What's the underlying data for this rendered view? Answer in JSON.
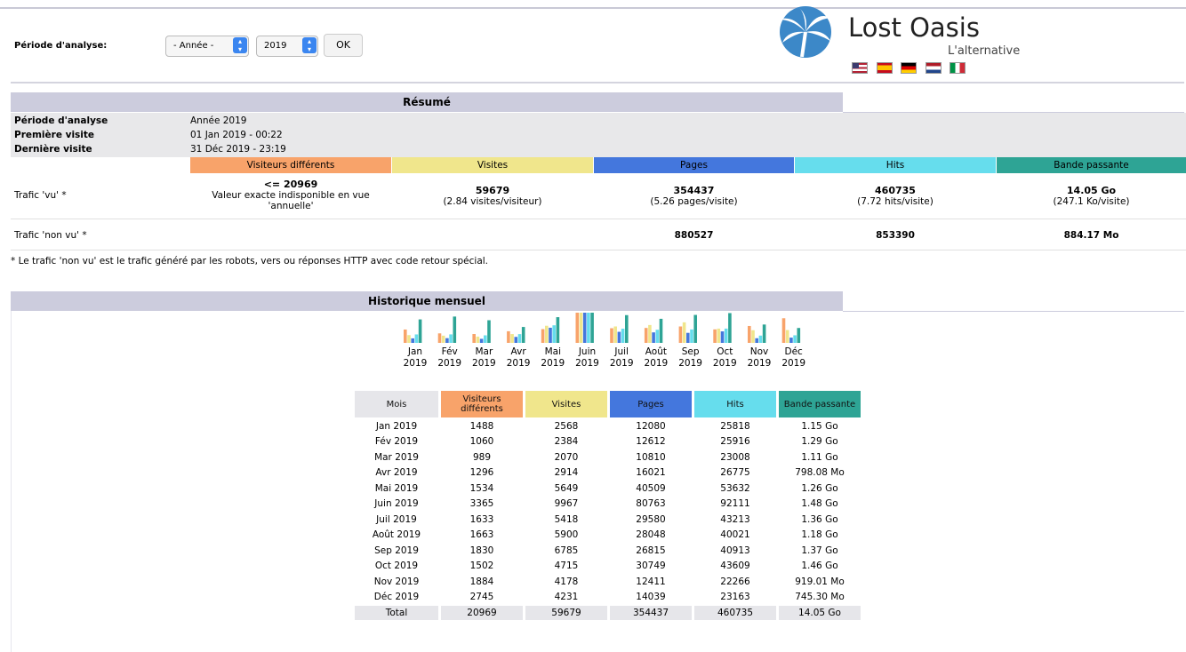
{
  "period": {
    "label": "Période d'analyse:",
    "select_period": "- Année -",
    "select_year": "2019",
    "ok_label": "OK"
  },
  "brand": {
    "name": "Lost Oasis",
    "tagline": "L'alternative",
    "flags": [
      "us-flag",
      "es-flag",
      "de-flag",
      "nl-flag",
      "it-flag"
    ]
  },
  "summary": {
    "title": "Résumé",
    "rows": [
      {
        "label": "Période d'analyse",
        "value": "Année 2019"
      },
      {
        "label": "Première visite",
        "value": "01 Jan 2019 - 00:22"
      },
      {
        "label": "Dernière visite",
        "value": "31 Déc 2019 - 23:19"
      }
    ],
    "columns": [
      "Visiteurs différents",
      "Visites",
      "Pages",
      "Hits",
      "Bande passante"
    ],
    "viewed": {
      "label": "Trafic 'vu' *",
      "visitors": "<= 20969",
      "visitors_note": "Valeur exacte indisponible en vue 'annuelle'",
      "visits": "59679",
      "visits_sub": "(2.84 visites/visiteur)",
      "pages": "354437",
      "pages_sub": "(5.26 pages/visite)",
      "hits": "460735",
      "hits_sub": "(7.72 hits/visite)",
      "bandwidth": "14.05 Go",
      "bandwidth_sub": "(247.1 Ko/visite)"
    },
    "not_viewed": {
      "label": "Trafic 'non vu' *",
      "pages": "880527",
      "hits": "853390",
      "bandwidth": "884.17 Mo"
    },
    "note": "* Le trafic 'non vu' est le trafic généré par les robots, vers ou réponses HTTP avec code retour spécial."
  },
  "monthly": {
    "title": "Historique mensuel",
    "headers": [
      "Mois",
      "Visiteurs différents",
      "Visites",
      "Pages",
      "Hits",
      "Bande passante"
    ],
    "rows": [
      [
        "Jan 2019",
        "1488",
        "2568",
        "12080",
        "25818",
        "1.15 Go"
      ],
      [
        "Fév 2019",
        "1060",
        "2384",
        "12612",
        "25916",
        "1.29 Go"
      ],
      [
        "Mar 2019",
        "989",
        "2070",
        "10810",
        "23008",
        "1.11 Go"
      ],
      [
        "Avr 2019",
        "1296",
        "2914",
        "16021",
        "26775",
        "798.08 Mo"
      ],
      [
        "Mai 2019",
        "1534",
        "5649",
        "40509",
        "53632",
        "1.26 Go"
      ],
      [
        "Juin 2019",
        "3365",
        "9967",
        "80763",
        "92111",
        "1.48 Go"
      ],
      [
        "Juil 2019",
        "1633",
        "5418",
        "29580",
        "43213",
        "1.36 Go"
      ],
      [
        "Août 2019",
        "1663",
        "5900",
        "28048",
        "40021",
        "1.18 Go"
      ],
      [
        "Sep 2019",
        "1830",
        "6785",
        "26815",
        "40913",
        "1.37 Go"
      ],
      [
        "Oct 2019",
        "1502",
        "4715",
        "30749",
        "43609",
        "1.46 Go"
      ],
      [
        "Nov 2019",
        "1884",
        "4178",
        "12411",
        "22266",
        "919.01 Mo"
      ],
      [
        "Déc 2019",
        "2745",
        "4231",
        "14039",
        "23163",
        "745.30 Mo"
      ]
    ],
    "total": [
      "Total",
      "20969",
      "59679",
      "354437",
      "460735",
      "14.05 Go"
    ],
    "chart_months": [
      [
        "Jan",
        "2019"
      ],
      [
        "Fév",
        "2019"
      ],
      [
        "Mar",
        "2019"
      ],
      [
        "Avr",
        "2019"
      ],
      [
        "Mai",
        "2019"
      ],
      [
        "Juin",
        "2019"
      ],
      [
        "Juil",
        "2019"
      ],
      [
        "Août",
        "2019"
      ],
      [
        "Sep",
        "2019"
      ],
      [
        "Oct",
        "2019"
      ],
      [
        "Nov",
        "2019"
      ],
      [
        "Déc",
        "2019"
      ]
    ]
  },
  "chart_data": {
    "type": "bar",
    "categories": [
      "Jan 2019",
      "Fév 2019",
      "Mar 2019",
      "Avr 2019",
      "Mai 2019",
      "Juin 2019",
      "Juil 2019",
      "Août 2019",
      "Sep 2019",
      "Oct 2019",
      "Nov 2019",
      "Déc 2019"
    ],
    "series": [
      {
        "values": [
          1488,
          1060,
          989,
          1296,
          1534,
          3365,
          1633,
          1663,
          1830,
          1502,
          1884,
          2745
        ],
        "color": "#f8a36a"
      },
      {
        "values": [
          2568,
          2384,
          2070,
          2914,
          5649,
          9967,
          5418,
          5900,
          6785,
          4715,
          4178,
          4231
        ],
        "color": "#f0e68c"
      },
      {
        "values": [
          12080,
          12612,
          10810,
          16021,
          40509,
          80763,
          29580,
          28048,
          26815,
          30749,
          12411,
          14039
        ],
        "color": "#4477dd"
      },
      {
        "values": [
          25818,
          25916,
          23008,
          26775,
          53632,
          92111,
          43213,
          40021,
          40913,
          43609,
          22266,
          23163
        ],
        "color": "#66dded"
      },
      {
        "values": [
          1.15,
          1.29,
          1.11,
          0.78,
          1.26,
          1.48,
          1.36,
          1.18,
          1.37,
          1.46,
          0.9,
          0.73
        ],
        "color": "#2ea495"
      }
    ]
  },
  "colors": {
    "visitors": "#f8a36a",
    "visits": "#f0e68c",
    "pages": "#4477dd",
    "hits": "#66dded",
    "bandwidth": "#2ea495",
    "header_bg": "#ccccdd"
  }
}
